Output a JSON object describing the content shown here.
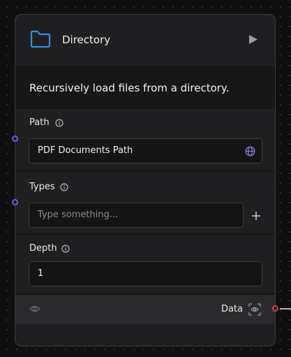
{
  "node": {
    "title": "Directory",
    "description": "Recursively load files from a directory.",
    "icon": "folder-icon",
    "accent_color": "#2f8fe3"
  },
  "fields": {
    "path": {
      "label": "Path",
      "value": "PDF Documents Path"
    },
    "types": {
      "label": "Types",
      "placeholder": "Type something..."
    },
    "depth": {
      "label": "Depth",
      "value": "1"
    }
  },
  "output": {
    "label": "Data"
  },
  "colors": {
    "input_handle": "#6b63e6",
    "output_handle": "#e0424b"
  }
}
